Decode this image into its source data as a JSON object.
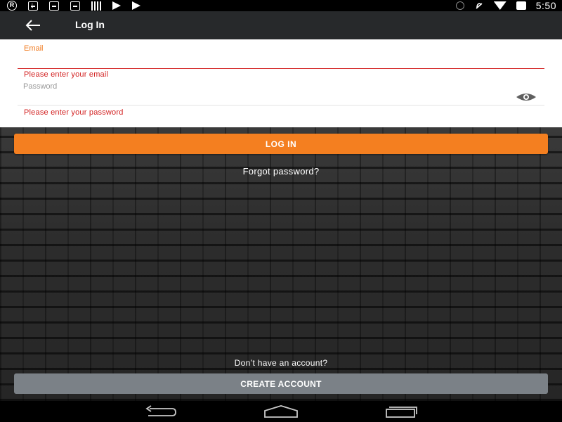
{
  "status_bar": {
    "time": "5:50",
    "left_icons": [
      "registered-icon",
      "download-icon",
      "message-icon",
      "message-icon",
      "barcode-icon",
      "play-store-icon",
      "play-icon"
    ],
    "right_icons": [
      "bluetooth-icon",
      "no-notifications-icon",
      "wifi-icon",
      "battery-icon"
    ]
  },
  "app_bar": {
    "title": "Log In",
    "back_icon": "arrow-left-icon"
  },
  "form": {
    "email": {
      "label": "Email",
      "value": "",
      "error": "Please enter your email"
    },
    "password": {
      "placeholder": "Password",
      "value": "",
      "error": "Please enter your password",
      "toggle_icon": "eye-icon"
    }
  },
  "actions": {
    "login_label": "LOG IN",
    "forgot_label": "Forgot password?",
    "no_account_text": "Don’t have an account?",
    "create_label": "CREATE ACCOUNT"
  },
  "colors": {
    "accent": "#f47f20",
    "error": "#d21f1f",
    "app_bar": "#27292b",
    "secondary_button": "#7b8187"
  },
  "nav_bar": {
    "icons": [
      "back-nav-icon",
      "home-nav-icon",
      "recent-apps-icon"
    ]
  }
}
